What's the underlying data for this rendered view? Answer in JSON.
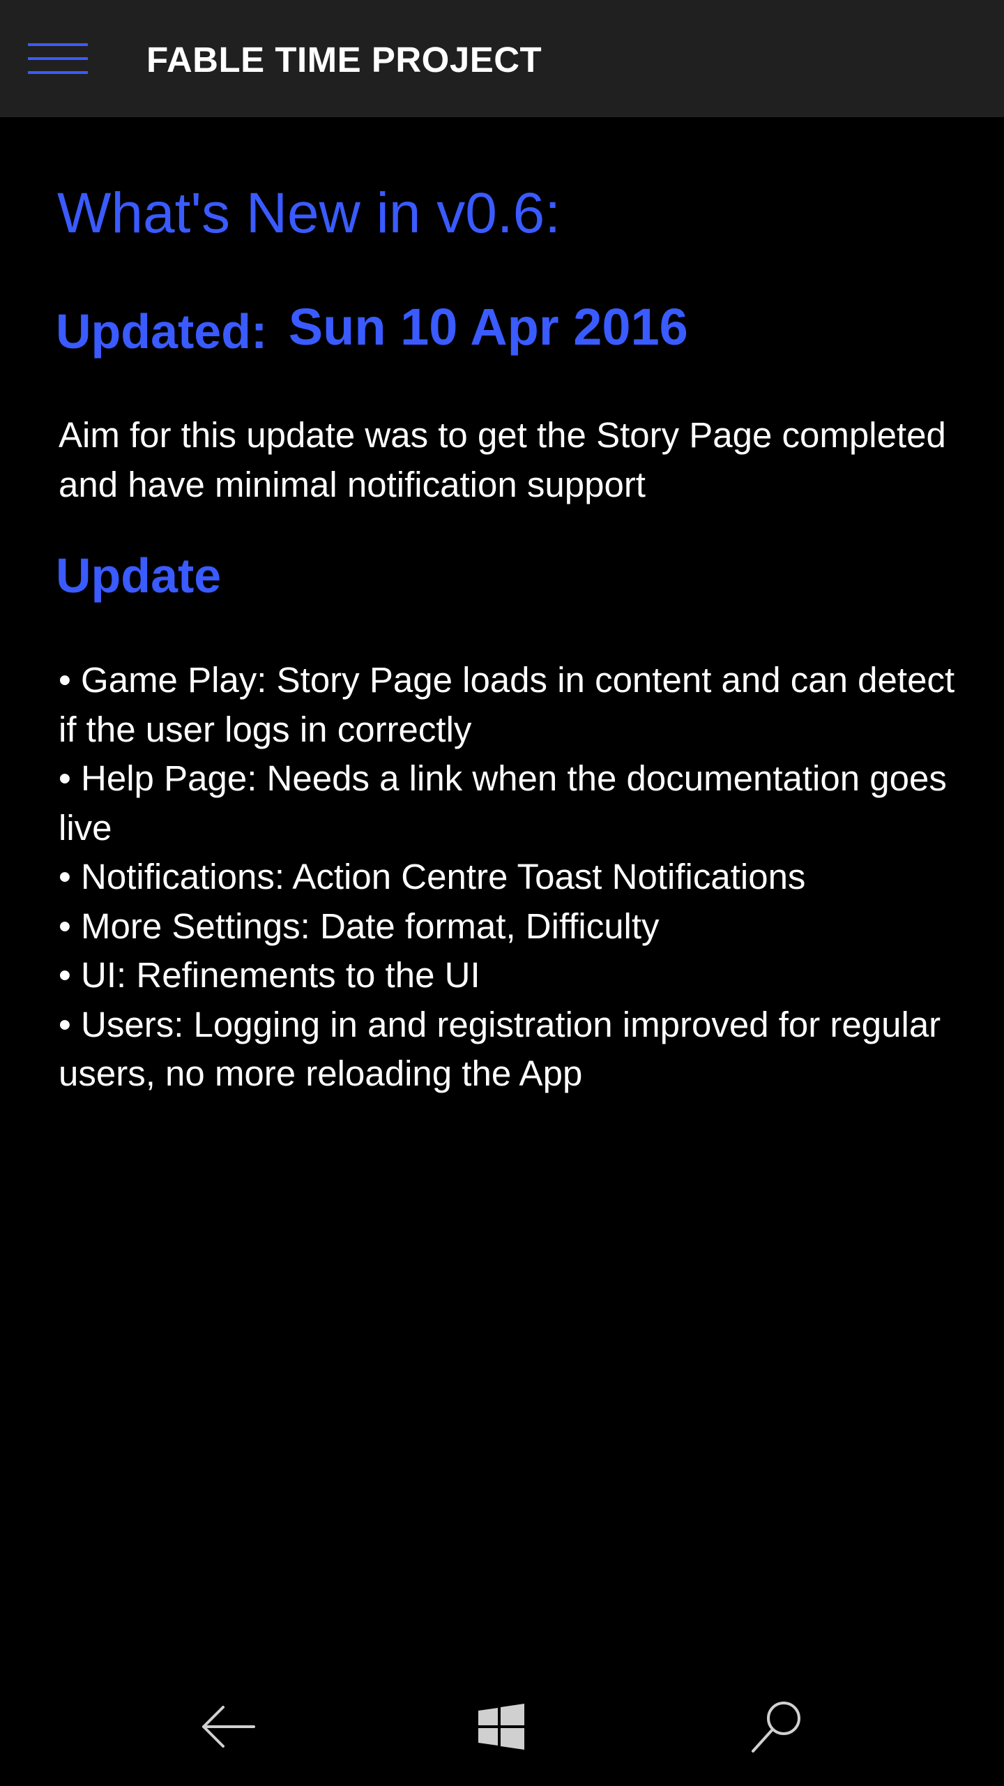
{
  "app_bar": {
    "menu_icon": "hamburger-menu-icon",
    "title": "FABLE TIME PROJECT"
  },
  "content": {
    "page_title": "What's New in v0.6:",
    "updated_label": "Updated:",
    "updated_date": "Sun 10 Apr 2016",
    "summary": "Aim for this update was to get the Story Page completed and have minimal notification support",
    "section_heading": "Update",
    "items": [
      "Game Play: Story Page loads in content and can detect if the user logs in correctly",
      "Help Page: Needs a link when the documentation goes live",
      "Notifications: Action Centre Toast Notifications",
      "More Settings: Date format, Difficulty",
      "UI: Refinements to the UI",
      "Users: Logging in and registration improved for regular users, no more reloading the App"
    ]
  },
  "nav_bar": {
    "back_icon": "back-arrow-icon",
    "home_icon": "windows-logo-icon",
    "search_icon": "search-icon"
  },
  "colors": {
    "accent": "#3a5bff",
    "background": "#000000",
    "app_bar": "#202020",
    "text": "#ffffff"
  }
}
